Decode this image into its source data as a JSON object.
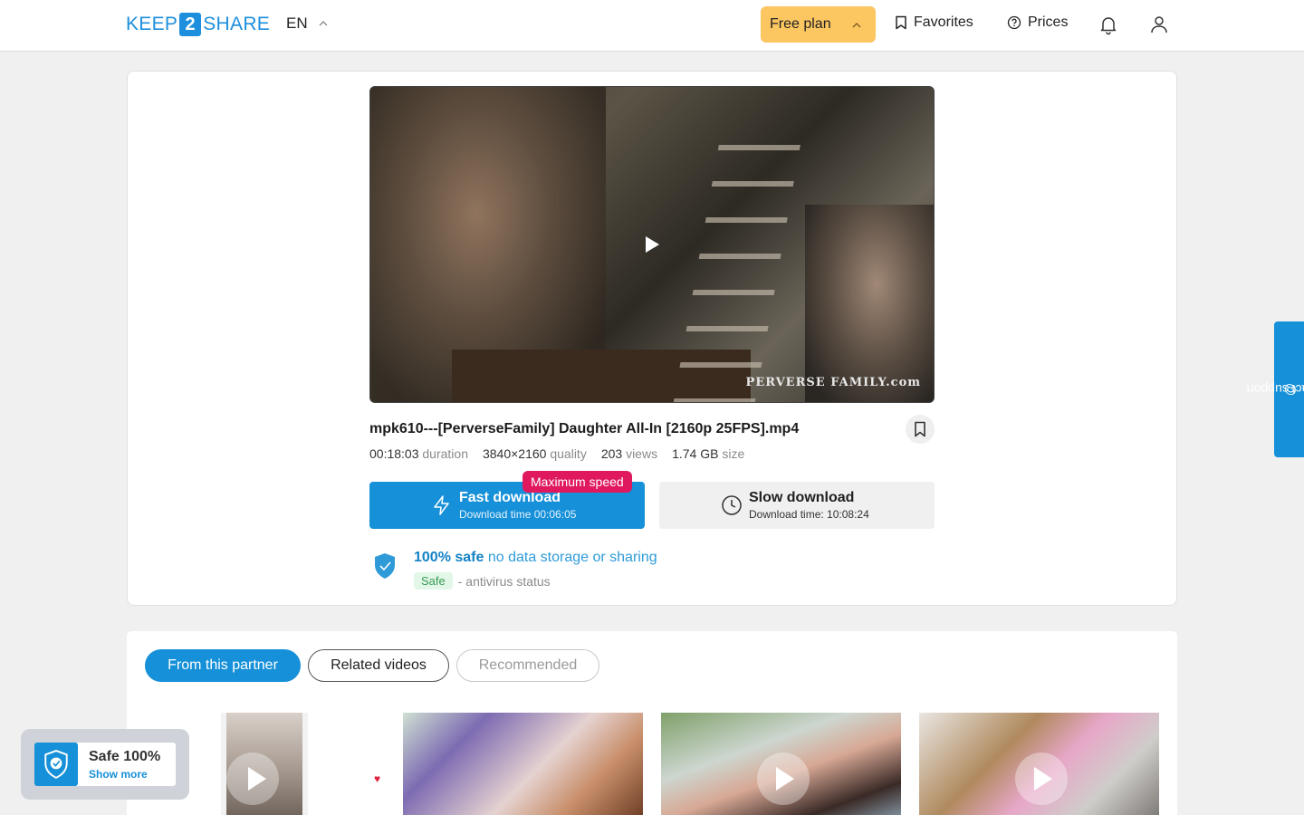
{
  "header": {
    "logo": {
      "left": "KEEP",
      "mid": "2",
      "right": "SHARE"
    },
    "language": "EN",
    "plan_label": "Free plan",
    "favorites_label": "Favorites",
    "prices_label": "Prices"
  },
  "file": {
    "player_watermark": "PERVERSE FAMILY.com",
    "title": "mpk610---[PerverseFamily] Daughter All-In [2160p 25FPS].mp4",
    "duration_value": "00:18:03",
    "duration_label": "duration",
    "quality_value": "3840×2160",
    "quality_label": "quality",
    "views_value": "203",
    "views_label": "views",
    "size_value": "1.74 GB",
    "size_label": "size"
  },
  "download": {
    "max_speed_badge": "Maximum speed",
    "fast_label": "Fast download",
    "fast_time": "Download time 00:06:05",
    "slow_label": "Slow download",
    "slow_time": "Download time: 10:08:24"
  },
  "safety": {
    "strong": "100% safe",
    "lite": "no data storage or sharing",
    "status_pill": "Safe",
    "status_text": "- antivirus status"
  },
  "tabs": [
    {
      "label": "From this partner"
    },
    {
      "label": "Related videos"
    },
    {
      "label": "Recommended"
    }
  ],
  "safe_widget": {
    "title": "Safe 100%",
    "subtitle": "Show more"
  },
  "support_label": "contact support",
  "colors": {
    "accent": "#1690d8",
    "plan": "#fcc661",
    "badge": "#e0195f"
  }
}
